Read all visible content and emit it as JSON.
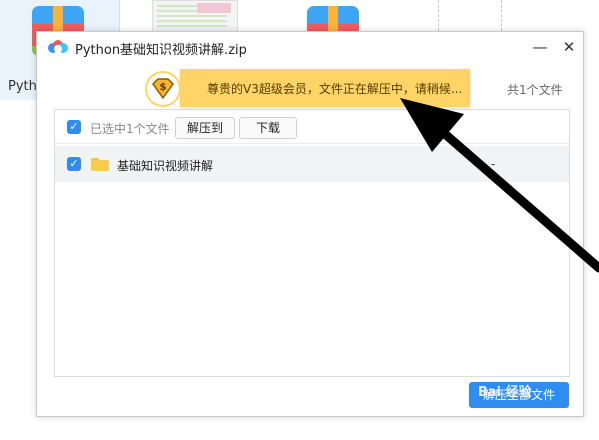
{
  "background": {
    "left_label": "Pytho",
    "colors": {
      "tile": "#e8f3fb"
    }
  },
  "dialog": {
    "title": "Python基础知识视频讲解.zip",
    "minimize_glyph": "—",
    "close_glyph": "✕",
    "file_count": "共1个文件",
    "toolbar": {
      "selected_label": "已选中1个文件",
      "extract_label": "解压到",
      "download_label": "下载"
    },
    "files": [
      {
        "name": "基础知识视频讲解",
        "size": "-",
        "type": "folder",
        "checked": true
      }
    ],
    "primary_button": "解压全部文件"
  },
  "toast": {
    "message": "尊贵的V3超级会员，文件正在解压中，请稍候...",
    "badge_symbol": "$"
  },
  "watermark": "Bai 经验",
  "colors": {
    "accent": "#2f8cf0",
    "toast_bg": "#fdd465",
    "folder": "#f7cb4d"
  }
}
